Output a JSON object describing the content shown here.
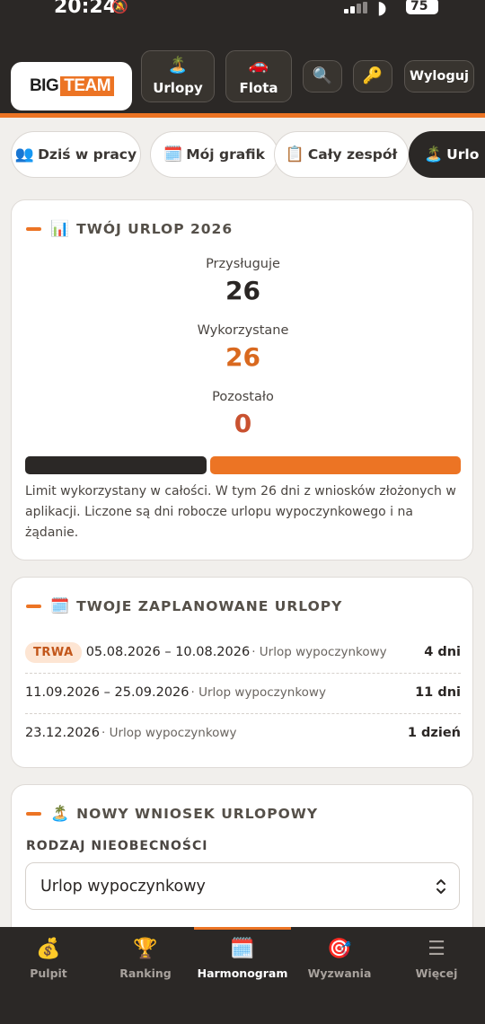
{
  "status": {
    "time": "20:24",
    "battery": "75"
  },
  "header": {
    "logo_big": "BIG",
    "logo_team": "TEAM",
    "buttons": [
      {
        "icon": "beach-umbrella-icon",
        "glyph": "🏝️",
        "label": "Urlopy"
      },
      {
        "icon": "car-icon",
        "glyph": "🚗",
        "label": "Flota"
      },
      {
        "icon": "search-icon",
        "glyph": "🔍"
      },
      {
        "icon": "key-icon",
        "glyph": "🔑"
      }
    ],
    "logout": "Wyloguj"
  },
  "tabs": [
    {
      "glyph": "👥",
      "label": "Dziś w pracy"
    },
    {
      "glyph": "🗓️",
      "label": "Mój grafik"
    },
    {
      "glyph": "📋",
      "label": "Cały zespół"
    },
    {
      "glyph": "🏝️",
      "label": "Urlo"
    }
  ],
  "summary": {
    "glyph": "📊",
    "title": "TWÓJ URLOP 2026",
    "entitled_label": "Przysługuje",
    "entitled": "26",
    "used_label": "Wykorzystane",
    "used": "26",
    "remaining_label": "Pozostało",
    "remaining": "0",
    "progress_used_fraction": 1.0,
    "note": "Limit wykorzystany w całości. W tym 26 dni z wniosków złożonych w aplikacji. Liczone są dni robocze urlopu wypoczynkowego i na żądanie."
  },
  "planned": {
    "glyph": "🗓️",
    "title": "TWOJE ZAPLANOWANE URLOPY",
    "rows": [
      {
        "badge": "TRWA",
        "dates": "05.08.2026 – 10.08.2026",
        "type": "· Urlop wypoczynkowy",
        "days": "4 dni"
      },
      {
        "badge": "",
        "dates": "11.09.2026 – 25.09.2026",
        "type": "· Urlop wypoczynkowy",
        "days": "11 dni"
      },
      {
        "badge": "",
        "dates": "23.12.2026",
        "type": "· Urlop wypoczynkowy",
        "days": "1 dzień"
      }
    ]
  },
  "new_request": {
    "glyph": "🏝️",
    "title": "NOWY WNIOSEK URLOPOWY",
    "field_label": "RODZAJ NIEOBECNOŚCI",
    "selected": "Urlop wypoczynkowy"
  },
  "nav": [
    {
      "glyph": "💰",
      "label": "Pulpit"
    },
    {
      "glyph": "🏆",
      "label": "Ranking"
    },
    {
      "glyph": "🗓️",
      "label": "Harmonogram",
      "active": true
    },
    {
      "glyph": "🎯",
      "label": "Wyzwania"
    },
    {
      "glyph": "☰",
      "label": "Więcej"
    }
  ],
  "colors": {
    "accent": "#ec7424",
    "dark": "#2b2826"
  }
}
